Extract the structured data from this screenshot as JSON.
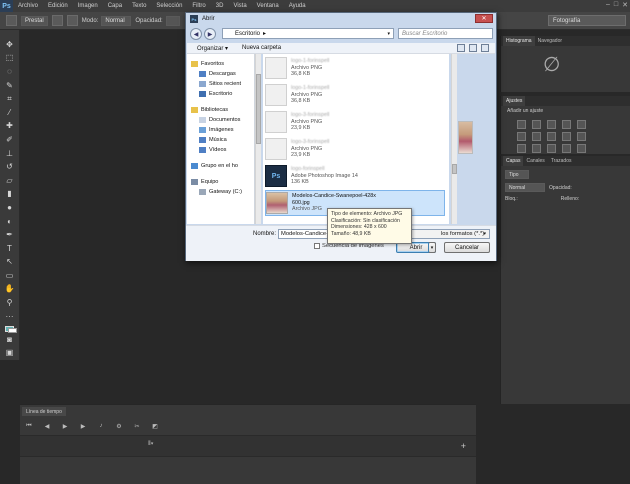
{
  "menubar": {
    "logo": "Ps",
    "items": [
      "Archivo",
      "Edición",
      "Imagen",
      "Capa",
      "Texto",
      "Selección",
      "Filtro",
      "3D",
      "Vista",
      "Ventana",
      "Ayuda"
    ],
    "window_controls": [
      "–",
      "□",
      "✕"
    ]
  },
  "optbar": {
    "preset": "Prestal",
    "mode_label": "Modo:",
    "mode_value": "Normal",
    "opacity_label": "Opacidad:",
    "workspace": "Fotografía"
  },
  "timeline": {
    "tab": "Línea de tiempo"
  },
  "panels": {
    "histogram_tabs": [
      "Histograma",
      "Navegador"
    ],
    "adjust_tabs": [
      "Ajustes"
    ],
    "adjust_title": "Añadir un ajuste",
    "layers_tabs": [
      "Capas",
      "Canales",
      "Trazados"
    ],
    "layers_kind": "Tipo",
    "layers_blend": "Normal",
    "layers_opacity_label": "Opacidad:",
    "layers_lock_label": "Bloq.:",
    "layers_fill_label": "Relleno:"
  },
  "dialog": {
    "title": "Abrir",
    "close": "✕",
    "address": "Escritorio",
    "search_placeholder": "Buscar Escritorio",
    "organize": "Organizar ▾",
    "new_folder": "Nueva carpeta",
    "nav": [
      {
        "label": "Favoritos",
        "color": "#e8c24a"
      },
      {
        "label": "Descargas",
        "color": "#4f7fc4"
      },
      {
        "label": "Sitios recient",
        "color": "#8aa7cf"
      },
      {
        "label": "Escritorio",
        "color": "#3f6fb0"
      },
      {
        "label": "",
        "color": ""
      },
      {
        "label": "Bibliotecas",
        "color": "#e8c24a"
      },
      {
        "label": "Documentos",
        "color": "#c7d3e4"
      },
      {
        "label": "Imágenes",
        "color": "#6aa0d8"
      },
      {
        "label": "Música",
        "color": "#4f7fc4"
      },
      {
        "label": "Vídeos",
        "color": "#4f7fc4"
      },
      {
        "label": "",
        "color": ""
      },
      {
        "label": "Grupo en el ho",
        "color": "#4a8ad0"
      },
      {
        "label": "",
        "color": ""
      },
      {
        "label": "Equipo",
        "color": "#7a8ca5"
      },
      {
        "label": "Gateway (C:)",
        "color": "#9aa7b8"
      }
    ],
    "files": [
      {
        "name": "logo-1-forinspell",
        "type": "Archivo PNG",
        "size": "36,8 KB",
        "kind": "png",
        "blurred": true
      },
      {
        "name": "logo-1-forinspell",
        "type": "Archivo PNG",
        "size": "36,8 KB",
        "kind": "png",
        "blurred": true
      },
      {
        "name": "logo-3-forinspell",
        "type": "Archivo PNG",
        "size": "23,9 KB",
        "kind": "png",
        "blurred": true
      },
      {
        "name": "logo-3-forinspell",
        "type": "Archivo PNG",
        "size": "23,9 KB",
        "kind": "png",
        "blurred": true
      },
      {
        "name": "logo-forinspell",
        "type": "Adobe Photoshop Image 14",
        "size": "136 KB",
        "kind": "psd",
        "blurred": true
      },
      {
        "name": "Modelos-Candice-Swanepoel-428x 600.jpg",
        "type": "Archivo JPG",
        "size": "",
        "kind": "jpg",
        "blurred": false
      }
    ],
    "tooltip": [
      "Tipo de elemento: Archivo JPG",
      "Clasificación: Sin clasificación",
      "Dimensiones: 428 x 600",
      "Tamaño: 48,9 KB"
    ],
    "name_label": "Nombre:",
    "name_value": "Modelos-Candice-Swanepoel-428x 600.jpg",
    "type_value": "los formatos (*.*)",
    "sequence_label": "Secuencia de imágenes",
    "open_label": "Abrir",
    "cancel_label": "Cancelar"
  }
}
